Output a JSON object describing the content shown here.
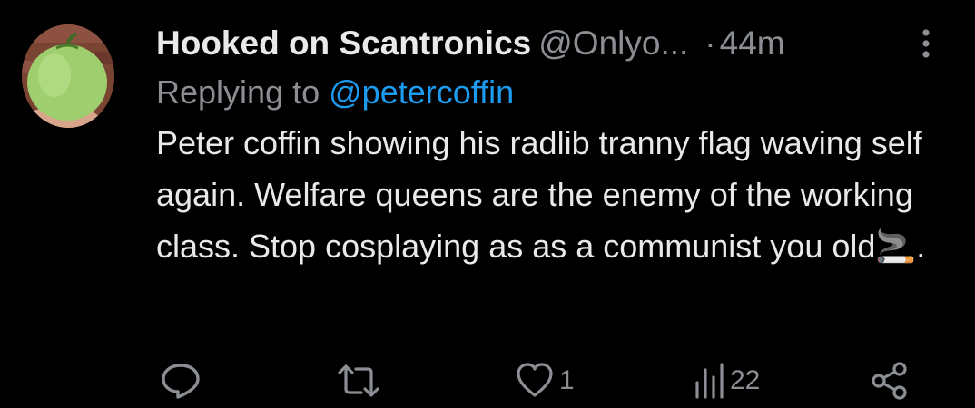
{
  "tweet": {
    "avatar_icon": "green-tomato-avatar",
    "display_name": "Hooked on Scantronics",
    "handle": "@Onlyo...",
    "separator": "·",
    "time": "44m",
    "more_icon": "more-vertical-icon",
    "replying_to_label": "Replying to",
    "replying_to_handle": "@petercoffin",
    "body_text": "Peter coffin showing his radlib tranny flag waving self again. Welfare queens are the enemy of the working class. Stop cosplaying as as a communist you old🚬.",
    "actions": {
      "reply": {
        "icon": "reply-icon",
        "count": ""
      },
      "retweet": {
        "icon": "retweet-icon",
        "count": ""
      },
      "like": {
        "icon": "heart-icon",
        "count": "1"
      },
      "views": {
        "icon": "views-chart-icon",
        "count": "22"
      },
      "share": {
        "icon": "share-icon",
        "count": ""
      }
    }
  },
  "colors": {
    "background": "#000000",
    "text_primary": "#e7e9ea",
    "text_secondary": "#8b8f94",
    "link_blue": "#1d9bf0"
  }
}
